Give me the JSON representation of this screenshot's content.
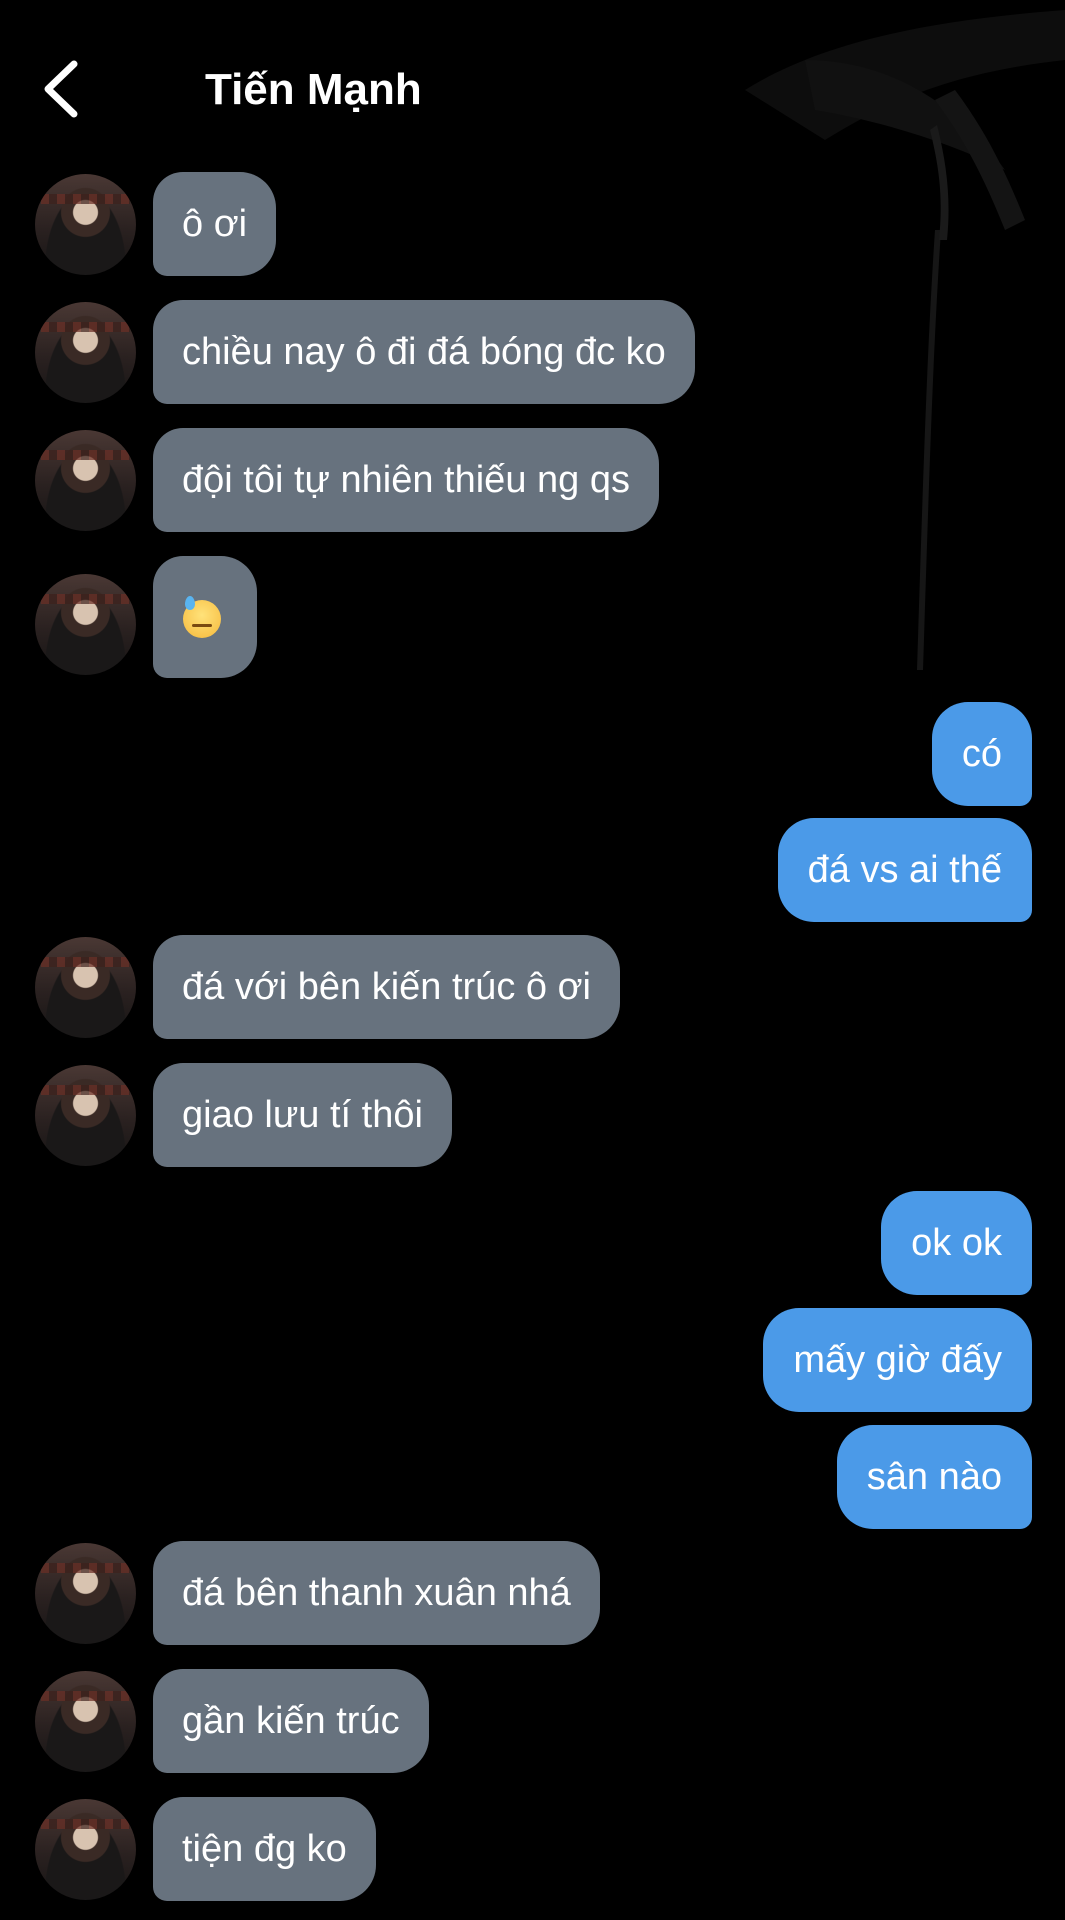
{
  "header": {
    "title": "Tiến Mạnh",
    "back_icon": "chevron-left-icon"
  },
  "colors": {
    "background": "#000000",
    "incoming_bubble": "#67727e",
    "outgoing_bubble": "#4b9ae8",
    "text": "#ffffff"
  },
  "messages": [
    {
      "side": "in",
      "text": "ô ơi"
    },
    {
      "side": "in",
      "text": "chiều nay ô đi đá bóng đc ko"
    },
    {
      "side": "in",
      "text": "đội tôi tự nhiên thiếu ng qs"
    },
    {
      "side": "in",
      "text": "",
      "emoji": "sweat-downcast-face-emoji"
    },
    {
      "side": "out",
      "text": "có"
    },
    {
      "side": "out",
      "text": "đá vs ai thế"
    },
    {
      "side": "in",
      "text": "đá với bên kiến trúc ô ơi"
    },
    {
      "side": "in",
      "text": "giao lưu tí thôi"
    },
    {
      "side": "out",
      "text": "ok ok"
    },
    {
      "side": "out",
      "text": "mấy giờ đấy"
    },
    {
      "side": "out",
      "text": "sân nào"
    },
    {
      "side": "in",
      "text": "đá bên thanh xuân nhá"
    },
    {
      "side": "in",
      "text": "gần kiến trúc"
    },
    {
      "side": "in",
      "text": "tiện đg ko"
    }
  ]
}
